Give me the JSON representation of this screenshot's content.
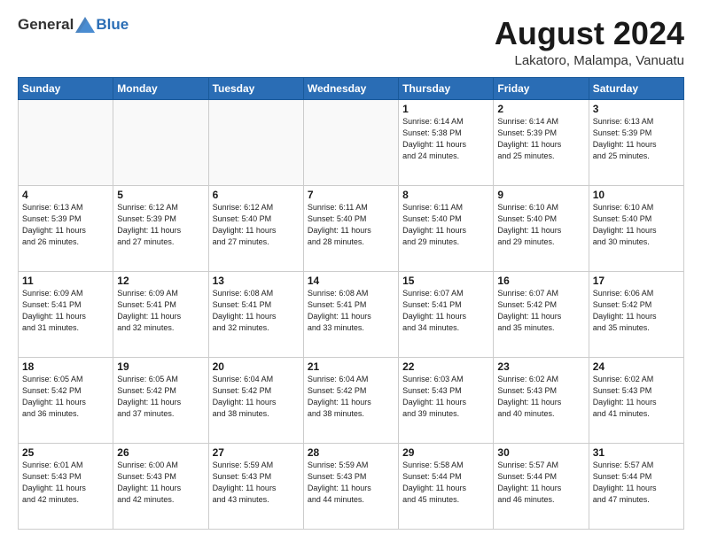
{
  "header": {
    "logo_general": "General",
    "logo_blue": "Blue",
    "main_title": "August 2024",
    "subtitle": "Lakatoro, Malampa, Vanuatu"
  },
  "days_of_week": [
    "Sunday",
    "Monday",
    "Tuesday",
    "Wednesday",
    "Thursday",
    "Friday",
    "Saturday"
  ],
  "weeks": [
    [
      {
        "day": "",
        "info": ""
      },
      {
        "day": "",
        "info": ""
      },
      {
        "day": "",
        "info": ""
      },
      {
        "day": "",
        "info": ""
      },
      {
        "day": "1",
        "info": "Sunrise: 6:14 AM\nSunset: 5:38 PM\nDaylight: 11 hours\nand 24 minutes."
      },
      {
        "day": "2",
        "info": "Sunrise: 6:14 AM\nSunset: 5:39 PM\nDaylight: 11 hours\nand 25 minutes."
      },
      {
        "day": "3",
        "info": "Sunrise: 6:13 AM\nSunset: 5:39 PM\nDaylight: 11 hours\nand 25 minutes."
      }
    ],
    [
      {
        "day": "4",
        "info": "Sunrise: 6:13 AM\nSunset: 5:39 PM\nDaylight: 11 hours\nand 26 minutes."
      },
      {
        "day": "5",
        "info": "Sunrise: 6:12 AM\nSunset: 5:39 PM\nDaylight: 11 hours\nand 27 minutes."
      },
      {
        "day": "6",
        "info": "Sunrise: 6:12 AM\nSunset: 5:40 PM\nDaylight: 11 hours\nand 27 minutes."
      },
      {
        "day": "7",
        "info": "Sunrise: 6:11 AM\nSunset: 5:40 PM\nDaylight: 11 hours\nand 28 minutes."
      },
      {
        "day": "8",
        "info": "Sunrise: 6:11 AM\nSunset: 5:40 PM\nDaylight: 11 hours\nand 29 minutes."
      },
      {
        "day": "9",
        "info": "Sunrise: 6:10 AM\nSunset: 5:40 PM\nDaylight: 11 hours\nand 29 minutes."
      },
      {
        "day": "10",
        "info": "Sunrise: 6:10 AM\nSunset: 5:40 PM\nDaylight: 11 hours\nand 30 minutes."
      }
    ],
    [
      {
        "day": "11",
        "info": "Sunrise: 6:09 AM\nSunset: 5:41 PM\nDaylight: 11 hours\nand 31 minutes."
      },
      {
        "day": "12",
        "info": "Sunrise: 6:09 AM\nSunset: 5:41 PM\nDaylight: 11 hours\nand 32 minutes."
      },
      {
        "day": "13",
        "info": "Sunrise: 6:08 AM\nSunset: 5:41 PM\nDaylight: 11 hours\nand 32 minutes."
      },
      {
        "day": "14",
        "info": "Sunrise: 6:08 AM\nSunset: 5:41 PM\nDaylight: 11 hours\nand 33 minutes."
      },
      {
        "day": "15",
        "info": "Sunrise: 6:07 AM\nSunset: 5:41 PM\nDaylight: 11 hours\nand 34 minutes."
      },
      {
        "day": "16",
        "info": "Sunrise: 6:07 AM\nSunset: 5:42 PM\nDaylight: 11 hours\nand 35 minutes."
      },
      {
        "day": "17",
        "info": "Sunrise: 6:06 AM\nSunset: 5:42 PM\nDaylight: 11 hours\nand 35 minutes."
      }
    ],
    [
      {
        "day": "18",
        "info": "Sunrise: 6:05 AM\nSunset: 5:42 PM\nDaylight: 11 hours\nand 36 minutes."
      },
      {
        "day": "19",
        "info": "Sunrise: 6:05 AM\nSunset: 5:42 PM\nDaylight: 11 hours\nand 37 minutes."
      },
      {
        "day": "20",
        "info": "Sunrise: 6:04 AM\nSunset: 5:42 PM\nDaylight: 11 hours\nand 38 minutes."
      },
      {
        "day": "21",
        "info": "Sunrise: 6:04 AM\nSunset: 5:42 PM\nDaylight: 11 hours\nand 38 minutes."
      },
      {
        "day": "22",
        "info": "Sunrise: 6:03 AM\nSunset: 5:43 PM\nDaylight: 11 hours\nand 39 minutes."
      },
      {
        "day": "23",
        "info": "Sunrise: 6:02 AM\nSunset: 5:43 PM\nDaylight: 11 hours\nand 40 minutes."
      },
      {
        "day": "24",
        "info": "Sunrise: 6:02 AM\nSunset: 5:43 PM\nDaylight: 11 hours\nand 41 minutes."
      }
    ],
    [
      {
        "day": "25",
        "info": "Sunrise: 6:01 AM\nSunset: 5:43 PM\nDaylight: 11 hours\nand 42 minutes."
      },
      {
        "day": "26",
        "info": "Sunrise: 6:00 AM\nSunset: 5:43 PM\nDaylight: 11 hours\nand 42 minutes."
      },
      {
        "day": "27",
        "info": "Sunrise: 5:59 AM\nSunset: 5:43 PM\nDaylight: 11 hours\nand 43 minutes."
      },
      {
        "day": "28",
        "info": "Sunrise: 5:59 AM\nSunset: 5:43 PM\nDaylight: 11 hours\nand 44 minutes."
      },
      {
        "day": "29",
        "info": "Sunrise: 5:58 AM\nSunset: 5:44 PM\nDaylight: 11 hours\nand 45 minutes."
      },
      {
        "day": "30",
        "info": "Sunrise: 5:57 AM\nSunset: 5:44 PM\nDaylight: 11 hours\nand 46 minutes."
      },
      {
        "day": "31",
        "info": "Sunrise: 5:57 AM\nSunset: 5:44 PM\nDaylight: 11 hours\nand 47 minutes."
      }
    ]
  ]
}
